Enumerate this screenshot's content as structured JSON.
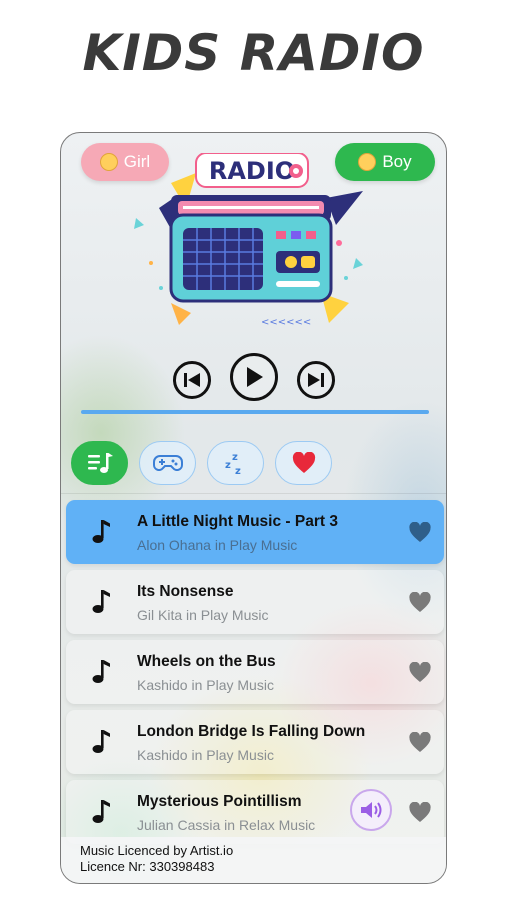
{
  "header": {
    "app_title": "KIDS RADIO"
  },
  "gender": {
    "girl_label": "Girl",
    "boy_label": "Boy"
  },
  "logo": {
    "radio_text": "RADIO"
  },
  "player": {
    "progress": 1.0
  },
  "tabs": [
    {
      "icon": "music-list-icon",
      "active": true
    },
    {
      "icon": "gamepad-icon",
      "active": false
    },
    {
      "icon": "sleep-zzz-icon",
      "active": false
    },
    {
      "icon": "heart-icon",
      "active": false
    }
  ],
  "songs": [
    {
      "title": "A Little Night Music - Part 3",
      "subtitle": "Alon Ohana in Play Music",
      "active": true
    },
    {
      "title": "Its Nonsense",
      "subtitle": "Gil Kita in Play Music",
      "active": false
    },
    {
      "title": "Wheels on the Bus",
      "subtitle": "Kashido in Play Music",
      "active": false
    },
    {
      "title": "London Bridge Is Falling Down",
      "subtitle": "Kashido in Play Music",
      "active": false
    },
    {
      "title": "Mysterious Pointillism",
      "subtitle": "Julian Cassia in Relax Music",
      "active": false
    }
  ],
  "footer": {
    "licence_line1": "Music Licenced by Artist.io",
    "licence_line2": "Licence Nr: 330398483"
  },
  "colors": {
    "accent_green": "#2eb84f",
    "accent_blue": "#60b1f6",
    "girl_pink": "#f6a9b6"
  }
}
